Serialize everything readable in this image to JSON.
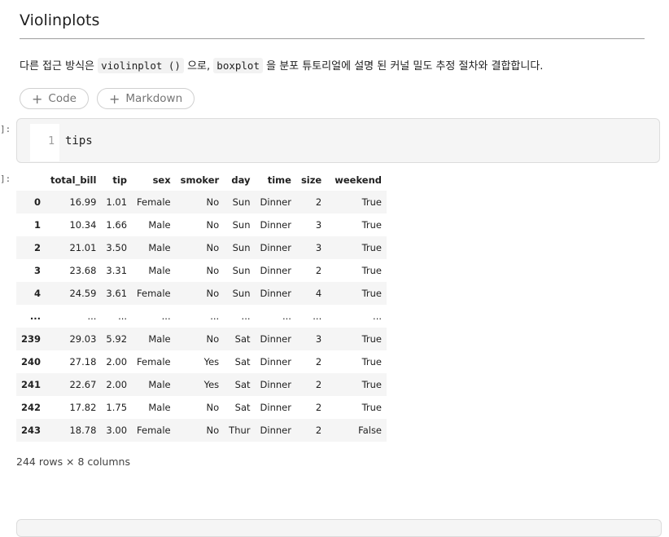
{
  "heading": "Violinplots",
  "paragraph": {
    "part1": "다른 접근 방식은 ",
    "code1": "violinplot ()",
    "part2": " 으로, ",
    "code2": "boxplot",
    "part3": " 을 분포 튜토리얼에 설명 된 커널 밀도 추정 절차와 결합합니다."
  },
  "add_buttons": {
    "code_label": "Code",
    "markdown_label": "Markdown",
    "plus": "+"
  },
  "input_cell": {
    "prompt": "]:",
    "line_number": "1",
    "code": "tips"
  },
  "output": {
    "prompt": "]:",
    "table": {
      "index_header": "",
      "columns": [
        "total_bill",
        "tip",
        "sex",
        "smoker",
        "day",
        "time",
        "size",
        "weekend"
      ],
      "rows": [
        {
          "index": "0",
          "cells": [
            "16.99",
            "1.01",
            "Female",
            "No",
            "Sun",
            "Dinner",
            "2",
            "True"
          ]
        },
        {
          "index": "1",
          "cells": [
            "10.34",
            "1.66",
            "Male",
            "No",
            "Sun",
            "Dinner",
            "3",
            "True"
          ]
        },
        {
          "index": "2",
          "cells": [
            "21.01",
            "3.50",
            "Male",
            "No",
            "Sun",
            "Dinner",
            "3",
            "True"
          ]
        },
        {
          "index": "3",
          "cells": [
            "23.68",
            "3.31",
            "Male",
            "No",
            "Sun",
            "Dinner",
            "2",
            "True"
          ]
        },
        {
          "index": "4",
          "cells": [
            "24.59",
            "3.61",
            "Female",
            "No",
            "Sun",
            "Dinner",
            "4",
            "True"
          ]
        },
        {
          "index": "...",
          "cells": [
            "...",
            "...",
            "...",
            "...",
            "...",
            "...",
            "...",
            "..."
          ]
        },
        {
          "index": "239",
          "cells": [
            "29.03",
            "5.92",
            "Male",
            "No",
            "Sat",
            "Dinner",
            "3",
            "True"
          ]
        },
        {
          "index": "240",
          "cells": [
            "27.18",
            "2.00",
            "Female",
            "Yes",
            "Sat",
            "Dinner",
            "2",
            "True"
          ]
        },
        {
          "index": "241",
          "cells": [
            "22.67",
            "2.00",
            "Male",
            "Yes",
            "Sat",
            "Dinner",
            "2",
            "True"
          ]
        },
        {
          "index": "242",
          "cells": [
            "17.82",
            "1.75",
            "Male",
            "No",
            "Sat",
            "Dinner",
            "2",
            "True"
          ]
        },
        {
          "index": "243",
          "cells": [
            "18.78",
            "3.00",
            "Female",
            "No",
            "Thur",
            "Dinner",
            "2",
            "False"
          ]
        }
      ]
    },
    "row_count": "244 rows × 8 columns"
  }
}
